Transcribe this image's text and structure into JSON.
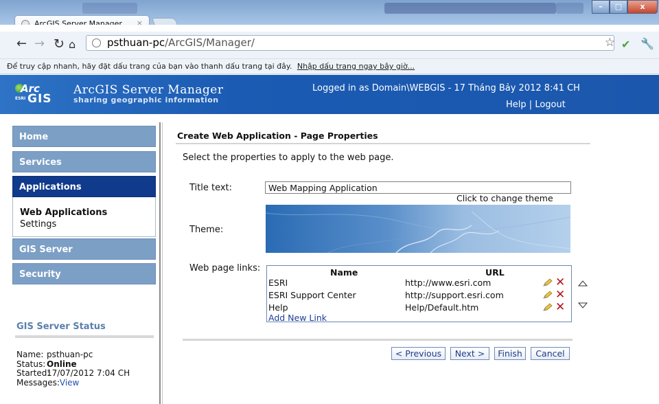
{
  "browser": {
    "tab_title": "ArcGIS Server Manager",
    "tab_close": "×",
    "url_host": "psthuan-pc",
    "url_path": "/ArcGIS/Manager/",
    "bookmark_prompt": "Để truy cập nhanh, hãy đặt dấu trang của bạn vào thanh dấu trang tại đây.",
    "bookmark_link": "Nhập dấu trang ngay bây giờ...",
    "icons": [
      "back-icon",
      "forward-icon",
      "reload-icon",
      "home-icon",
      "star-icon",
      "check-icon",
      "wrench-icon"
    ]
  },
  "header": {
    "logo_arc": "Arc",
    "logo_gis": "GIS",
    "logo_esri": "ESRI",
    "title": "ArcGIS Server Manager",
    "subtitle": "sharing geographic information",
    "login_info": "Logged in as Domain\\WEBGIS - 17 Tháng Bảy 2012 8:41 CH",
    "help": "Help",
    "separator": "|",
    "logout": "Logout"
  },
  "sidebar": {
    "items": [
      {
        "label": "Home"
      },
      {
        "label": "Services"
      },
      {
        "label": "Applications"
      },
      {
        "label": "GIS Server"
      },
      {
        "label": "Security"
      }
    ],
    "subitems": [
      {
        "label": "Web Applications"
      },
      {
        "label": "Settings"
      }
    ],
    "status": {
      "heading": "GIS Server Status",
      "name_label": "Name:",
      "name_value": "psthuan-pc",
      "status_label": "Status:",
      "status_value": "Online",
      "started_label": "Started:",
      "started_value": "17/07/2012 7:04 CH",
      "messages_label": "Messages:",
      "messages_link": "View"
    }
  },
  "main": {
    "title": "Create Web Application - Page Properties",
    "instruction": "Select the properties to apply to the web page.",
    "title_text_label": "Title text:",
    "title_text_value": "Web Mapping Application",
    "theme_hint": "Click to change theme",
    "theme_label": "Theme:",
    "links_label": "Web page links:",
    "links_table": {
      "col_name": "Name",
      "col_url": "URL",
      "rows": [
        {
          "name": "ESRI",
          "url": "http://www.esri.com"
        },
        {
          "name": "ESRI Support Center",
          "url": "http://support.esri.com"
        },
        {
          "name": "Help",
          "url": "Help/Default.htm"
        }
      ],
      "delete_glyph": "✕",
      "add_link": "Add New Link"
    },
    "buttons": {
      "previous": "< Previous",
      "next": "Next >",
      "finish": "Finish",
      "cancel": "Cancel"
    }
  },
  "colors": {
    "header_blue": "#1b5bb3",
    "nav_inactive": "#7c9fc6",
    "nav_active": "#103a8b",
    "delete_red": "#b3141a",
    "link_blue": "#1c3c99"
  }
}
